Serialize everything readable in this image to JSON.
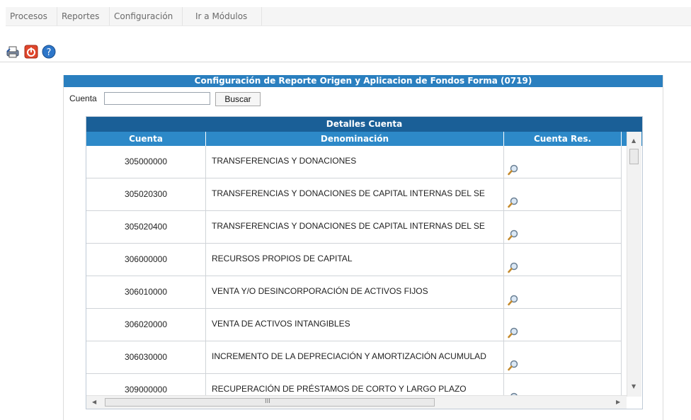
{
  "menu": {
    "items": [
      {
        "label": "Procesos"
      },
      {
        "label": "Reportes"
      },
      {
        "label": "Configuración"
      },
      {
        "label": "Ir a Módulos"
      }
    ]
  },
  "toolbar": {
    "icons": [
      "printer-icon",
      "power-off-icon",
      "help-icon"
    ]
  },
  "panel": {
    "title": "Configuración de Reporte Origen y Aplicacion de Fondos Forma (0719)"
  },
  "search": {
    "label": "Cuenta",
    "value": "",
    "button_label": "Buscar"
  },
  "grid": {
    "caption": "Detalles Cuenta",
    "columns": [
      "Cuenta",
      "Denominación",
      "Cuenta Res."
    ],
    "rows": [
      {
        "cuenta": "305000000",
        "denominacion": "TRANSFERENCIAS Y DONACIONES"
      },
      {
        "cuenta": "305020300",
        "denominacion": "TRANSFERENCIAS Y DONACIONES DE CAPITAL INTERNAS DEL SE"
      },
      {
        "cuenta": "305020400",
        "denominacion": "TRANSFERENCIAS Y DONACIONES DE CAPITAL INTERNAS DEL SE"
      },
      {
        "cuenta": "306000000",
        "denominacion": "RECURSOS PROPIOS DE CAPITAL"
      },
      {
        "cuenta": "306010000",
        "denominacion": "VENTA Y/O DESINCORPORACIÓN DE ACTIVOS FIJOS"
      },
      {
        "cuenta": "306020000",
        "denominacion": "VENTA DE ACTIVOS INTANGIBLES"
      },
      {
        "cuenta": "306030000",
        "denominacion": "INCREMENTO DE LA DEPRECIACIÓN Y AMORTIZACIÓN ACUMULAD"
      },
      {
        "cuenta": "309000000",
        "denominacion": "RECUPERACIÓN DE PRÉSTAMOS DE CORTO Y LARGO PLAZO"
      }
    ],
    "hscroll_label": "III"
  },
  "colors": {
    "header_blue": "#2d89c8",
    "caption_blue": "#1a5f97",
    "title_blue": "#2a7fbf"
  }
}
